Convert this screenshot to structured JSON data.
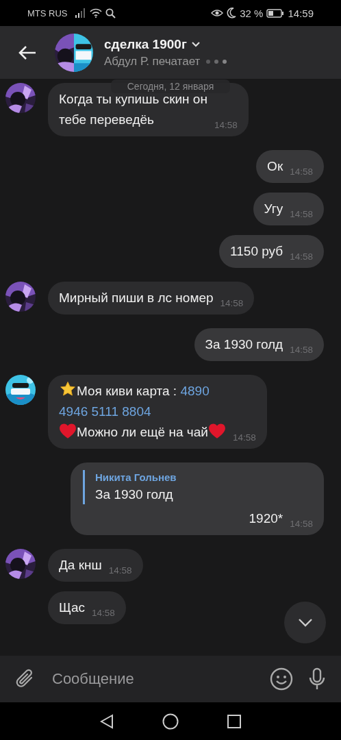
{
  "status_bar": {
    "carrier": "MTS RUS",
    "battery": "32 %",
    "time": "14:59"
  },
  "header": {
    "title": "сделка 1900г",
    "subtitle": "Абдул Р. печатает"
  },
  "date_pill": "Сегодня, 12 января",
  "messages": [
    {
      "kind": "incoming",
      "avatar": {
        "kind": "picture",
        "color": "#7a52b8"
      },
      "lines": [
        [
          {
            "kind": "text",
            "text": "Когда ты купишь скин он"
          }
        ],
        [
          {
            "kind": "text",
            "text": "тебе переведёь"
          }
        ]
      ],
      "time": "14:58"
    },
    {
      "kind": "outgoing",
      "lines": [
        [
          {
            "kind": "text",
            "text": "Ок"
          }
        ]
      ],
      "time": "14:58"
    },
    {
      "kind": "outgoing",
      "lines": [
        [
          {
            "kind": "text",
            "text": "Угу"
          }
        ]
      ],
      "time": "14:58"
    },
    {
      "kind": "outgoing",
      "lines": [
        [
          {
            "kind": "text",
            "text": "1150 руб"
          }
        ]
      ],
      "time": "14:58"
    },
    {
      "kind": "incoming",
      "avatar": {
        "kind": "picture",
        "color": "#7a52b8"
      },
      "lines": [
        [
          {
            "kind": "text",
            "text": "Мирный пиши в лс номер"
          }
        ]
      ],
      "time": "14:58"
    },
    {
      "kind": "outgoing",
      "lines": [
        [
          {
            "kind": "text",
            "text": "За 1930 голд"
          }
        ]
      ],
      "time": "14:58"
    },
    {
      "kind": "incoming",
      "avatar": {
        "kind": "picture",
        "color": "#3ec3e6"
      },
      "lines": [
        [
          {
            "kind": "star"
          },
          {
            "kind": "text",
            "text": "Моя киви карта : "
          },
          {
            "kind": "link",
            "text": "4890"
          }
        ],
        [
          {
            "kind": "link",
            "text": "4946 5111 8804"
          }
        ],
        [
          {
            "kind": "heart"
          },
          {
            "kind": "text",
            "text": "Можно ли ещё на чай"
          },
          {
            "kind": "heart"
          }
        ]
      ],
      "time": "14:58"
    },
    {
      "kind": "outgoing",
      "reply": {
        "author": "Никита Гольнев",
        "text": "За 1930 голд"
      },
      "lines": [
        [
          {
            "kind": "text",
            "text": "1920*"
          }
        ]
      ],
      "time": "14:58"
    },
    {
      "kind": "incoming",
      "avatar": {
        "kind": "picture",
        "color": "#7a52b8"
      },
      "lines": [
        [
          {
            "kind": "text",
            "text": "Да кнш"
          }
        ]
      ],
      "time": "14:58"
    },
    {
      "kind": "incoming",
      "lines": [
        [
          {
            "kind": "text",
            "text": "Щас"
          }
        ]
      ],
      "time": "14:58"
    }
  ],
  "input": {
    "placeholder": "Сообщение"
  }
}
